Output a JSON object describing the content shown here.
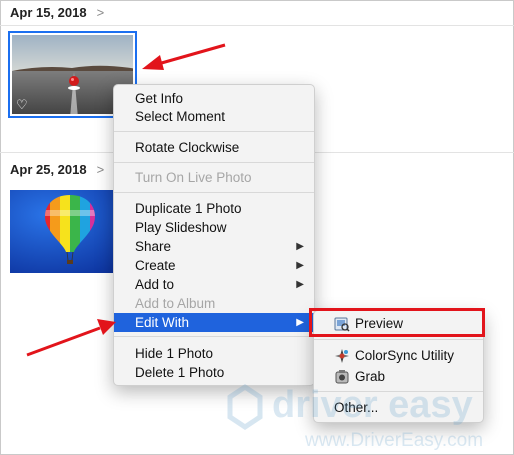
{
  "sections": [
    {
      "date": "Apr 15, 2018",
      "chevron": ">"
    },
    {
      "date": "Apr 25, 2018",
      "chevron": ">"
    }
  ],
  "context_menu": {
    "items": [
      {
        "label": "Get Info"
      },
      {
        "label": "Select Moment"
      },
      {
        "label": "Rotate Clockwise"
      },
      {
        "label": "Turn On Live Photo",
        "disabled": true
      },
      {
        "label": "Duplicate 1 Photo"
      },
      {
        "label": "Play Slideshow"
      },
      {
        "label": "Share",
        "submenu": true
      },
      {
        "label": "Create",
        "submenu": true
      },
      {
        "label": "Add to",
        "submenu": true
      },
      {
        "label": "Add to Album",
        "disabled": true
      },
      {
        "label": "Edit With",
        "submenu": true,
        "highlighted": true
      },
      {
        "label": "Hide 1 Photo"
      },
      {
        "label": "Delete 1 Photo"
      }
    ],
    "submenu_arrow": "▶"
  },
  "edit_with_submenu": {
    "items": [
      {
        "label": "Preview",
        "icon": "preview-app-icon"
      },
      {
        "label": "ColorSync Utility",
        "icon": "colorsync-app-icon"
      },
      {
        "label": "Grab",
        "icon": "grab-app-icon"
      },
      {
        "label": "Other..."
      }
    ]
  },
  "watermark": {
    "brand": "driver easy",
    "url": "www.DriverEasy.com"
  },
  "colors": {
    "highlight": "#1f63dd",
    "annotation_red": "#e2141b",
    "selection_border": "#1b6ff0"
  }
}
